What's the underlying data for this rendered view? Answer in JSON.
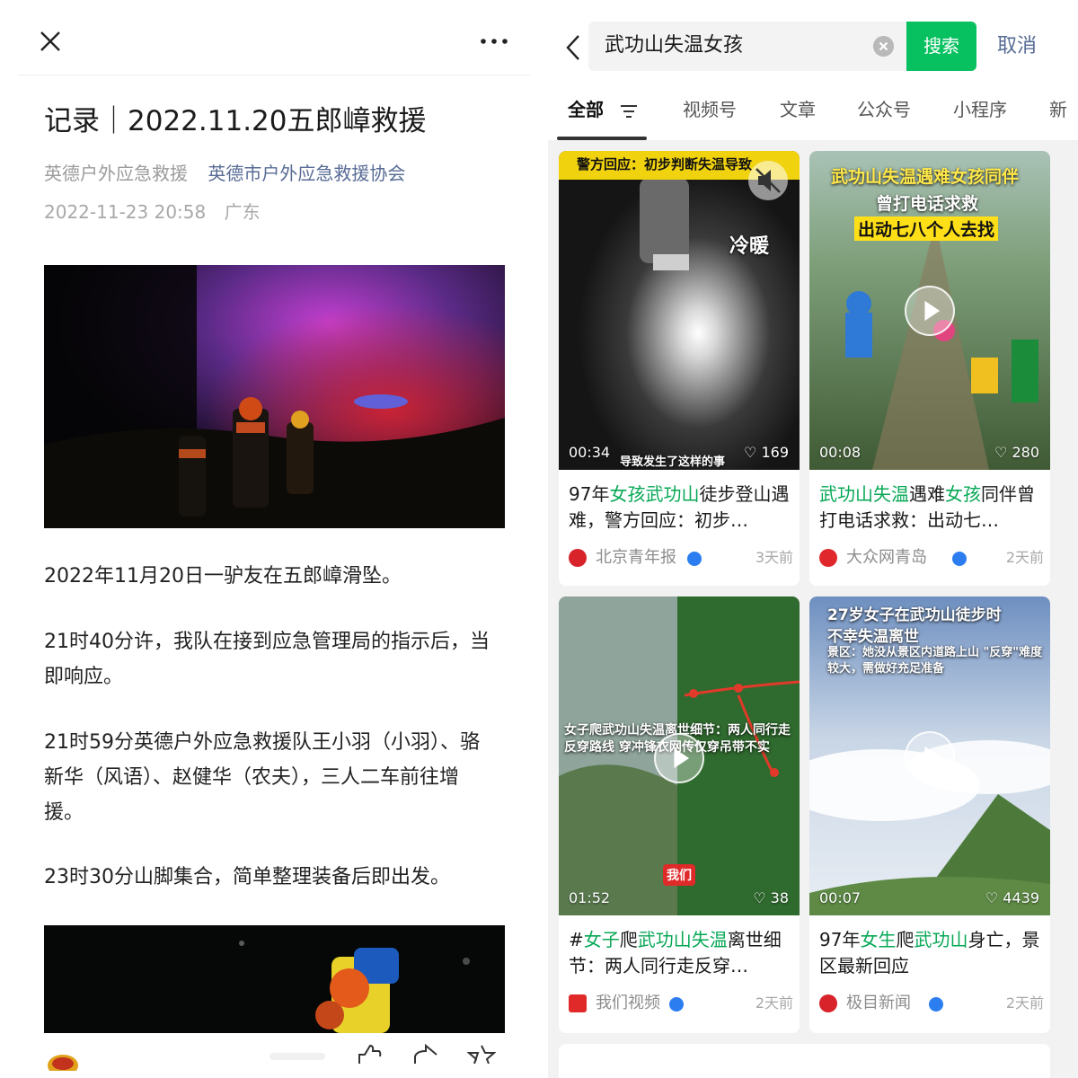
{
  "article": {
    "title": "记录｜2022.11.20五郎嶂救援",
    "source": "英德户外应急救援",
    "account": "英德市户外应急救援协会",
    "date": "2022-11-23 20:58",
    "location": "广东",
    "paragraphs": [
      "2022年11月20日一驴友在五郎嶂滑坠。",
      "21时40分许，我队在接到应急管理局的指示后，当即响应。",
      "21时59分英德户外应急救援队王小羽（小羽）、骆新华（风语）、赵健华（农夫），三人二车前往增援。",
      "23时30分山脚集合，简单整理装备后即出发。"
    ]
  },
  "search": {
    "query": "武功山失温女孩",
    "button_label": "搜索",
    "cancel_label": "取消"
  },
  "tabs": [
    {
      "label": "全部",
      "active": true
    },
    {
      "label": "视频号"
    },
    {
      "label": "文章"
    },
    {
      "label": "公众号"
    },
    {
      "label": "小程序"
    },
    {
      "label": "新"
    }
  ],
  "cards": [
    {
      "overlay_top": "警方回应：初步判断失温导致",
      "overlay_mid": "冷暖",
      "overlay_bottom": "导致发生了这样的事",
      "duration": "00:34",
      "likes": "169",
      "title_parts": [
        "97年",
        "女孩武功山",
        "徒步登山遇难，警方回应：初步…"
      ],
      "source": "北京青年报",
      "time": "3天前"
    },
    {
      "overlay_top": "武功山失温遇难女孩同伴",
      "overlay_mid": "曾打电话求救",
      "overlay_bottom": "出动七八个人去找",
      "duration": "00:08",
      "likes": "280",
      "title_parts": [
        "",
        "武功山失温",
        "遇难",
        "女孩",
        "同伴曾打电话求救：出动七…"
      ],
      "source": "大众网青岛",
      "time": "2天前"
    },
    {
      "overlay_top": "女子爬武功山失温离世细节：两人同行走反穿路线 穿冲锋衣网传仅穿吊带不实",
      "overlay_bottom": "我们",
      "duration": "01:52",
      "likes": "38",
      "title_parts": [
        "#",
        "女子",
        "爬",
        "武功山失温",
        "离世细节：两人同行走反穿…"
      ],
      "source": "我们视频",
      "time": "2天前"
    },
    {
      "overlay_top": "27岁女子在武功山徒步时",
      "overlay_mid": "不幸失温离世",
      "overlay_bottom": "景区：她没从景区内道路上山 \"反穿\"难度较大，需做好充足准备",
      "duration": "00:07",
      "likes": "4439",
      "title_parts": [
        "97年",
        "女生",
        "爬",
        "武功山",
        "身亡，景区最新回应"
      ],
      "source": "极目新闻",
      "time": "2天前"
    }
  ],
  "colors": {
    "accent_green": "#07c160",
    "link_blue": "#576b95",
    "verify_blue": "#2c7ef0"
  }
}
